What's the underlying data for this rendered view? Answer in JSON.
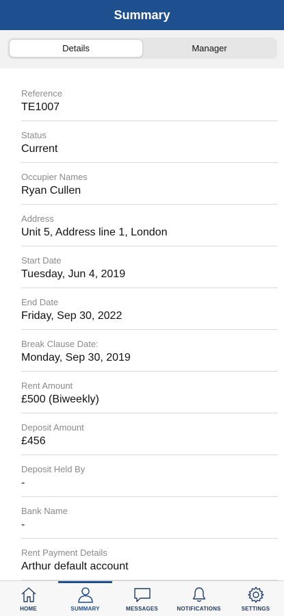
{
  "header": {
    "title": "Summary"
  },
  "segments": {
    "details": "Details",
    "manager": "Manager",
    "active": "details"
  },
  "fields": [
    {
      "label": "Reference",
      "value": "TE1007"
    },
    {
      "label": "Status",
      "value": "Current"
    },
    {
      "label": "Occupier Names",
      "value": "Ryan Cullen"
    },
    {
      "label": "Address",
      "value": "Unit 5, Address line 1, London"
    },
    {
      "label": "Start Date",
      "value": "Tuesday, Jun 4, 2019"
    },
    {
      "label": "End Date",
      "value": "Friday, Sep 30, 2022"
    },
    {
      "label": "Break Clause Date:",
      "value": "Monday, Sep 30, 2019"
    },
    {
      "label": "Rent Amount",
      "value": "£500 (Biweekly)"
    },
    {
      "label": "Deposit Amount",
      "value": "£456"
    },
    {
      "label": "Deposit Held By",
      "value": "-"
    },
    {
      "label": "Bank Name",
      "value": "-"
    },
    {
      "label": "Rent Payment Details",
      "value": "Arthur default account"
    }
  ],
  "tabbar": {
    "active": "summary",
    "items": [
      {
        "key": "home",
        "label": "HOME",
        "icon": "home-icon"
      },
      {
        "key": "summary",
        "label": "SUMMARY",
        "icon": "person-icon"
      },
      {
        "key": "messages",
        "label": "MESSAGES",
        "icon": "chat-bubble-icon"
      },
      {
        "key": "notifications",
        "label": "NOTIFICATIONS",
        "icon": "bell-icon"
      },
      {
        "key": "settings",
        "label": "SETTINGS",
        "icon": "gear-icon"
      }
    ]
  },
  "colors": {
    "brand": "#1e4f8f",
    "icon": "#1f3b63"
  }
}
